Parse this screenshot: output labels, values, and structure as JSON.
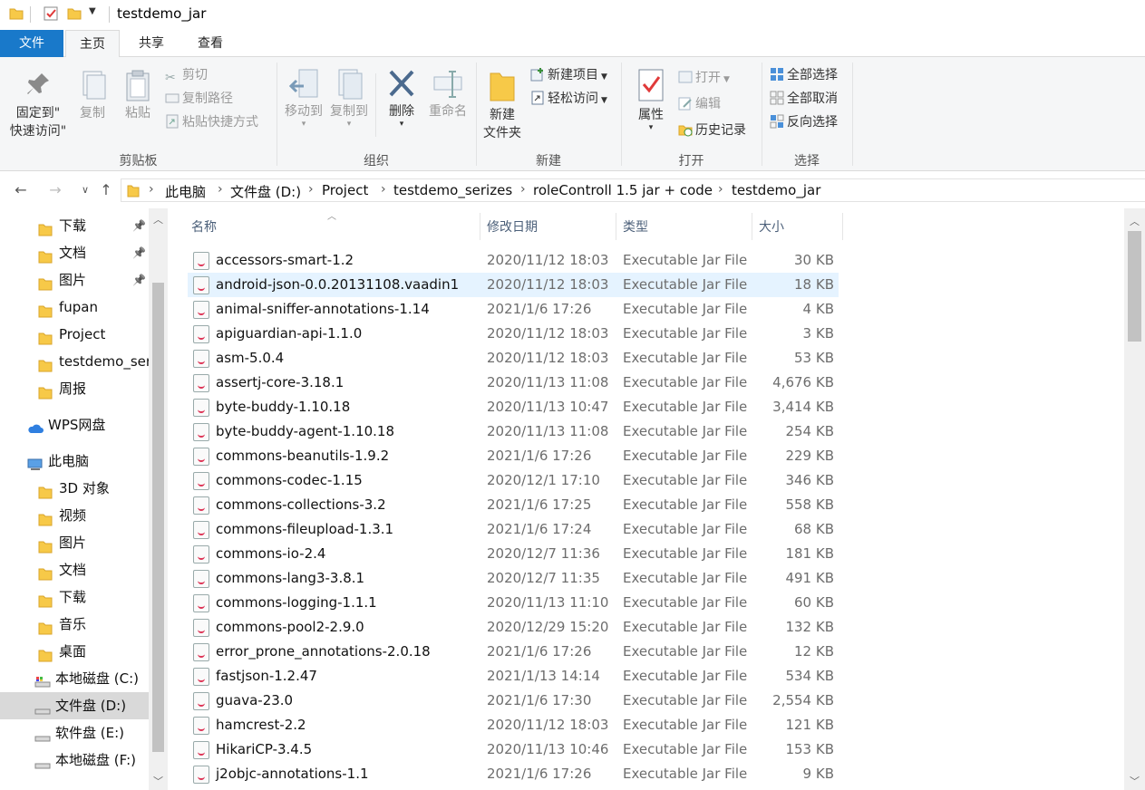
{
  "window": {
    "title": "testdemo_jar"
  },
  "ribbon_tabs": [
    "文件",
    "主页",
    "共享",
    "查看"
  ],
  "ribbon": {
    "clipboard": {
      "pin_label_1": "固定到\"",
      "pin_label_2": "快速访问\"",
      "copy": "复制",
      "paste": "粘贴",
      "cut": "剪切",
      "copy_path": "复制路径",
      "paste_shortcut": "粘贴快捷方式",
      "group": "剪贴板"
    },
    "organize": {
      "move_to": "移动到",
      "copy_to": "复制到",
      "delete": "删除",
      "rename": "重命名",
      "group": "组织"
    },
    "new": {
      "new_folder_1": "新建",
      "new_folder_2": "文件夹",
      "new_item": "新建项目",
      "easy_access": "轻松访问",
      "group": "新建"
    },
    "open": {
      "properties": "属性",
      "open": "打开",
      "edit": "编辑",
      "history": "历史记录",
      "group": "打开"
    },
    "select": {
      "select_all": "全部选择",
      "select_none": "全部取消",
      "invert": "反向选择",
      "group": "选择"
    }
  },
  "breadcrumbs": [
    "此电脑",
    "文件盘 (D:)",
    "Project",
    "testdemo_serizes",
    "roleControll 1.5 jar + code",
    "testdemo_jar"
  ],
  "nav_pane": [
    {
      "label": "下载",
      "pinned": true
    },
    {
      "label": "文档",
      "pinned": true
    },
    {
      "label": "图片",
      "pinned": true
    },
    {
      "label": "fupan",
      "pinned": false
    },
    {
      "label": "Project",
      "pinned": false
    },
    {
      "label": "testdemo_ser",
      "pinned": false
    },
    {
      "label": "周报",
      "pinned": false
    },
    {
      "label": "WPS网盘",
      "pinned": false
    },
    {
      "label": "此电脑",
      "pinned": false
    },
    {
      "label": "3D 对象",
      "pinned": false
    },
    {
      "label": "视频",
      "pinned": false
    },
    {
      "label": "图片",
      "pinned": false
    },
    {
      "label": "文档",
      "pinned": false
    },
    {
      "label": "下载",
      "pinned": false
    },
    {
      "label": "音乐",
      "pinned": false
    },
    {
      "label": "桌面",
      "pinned": false
    },
    {
      "label": "本地磁盘 (C:)",
      "pinned": false
    },
    {
      "label": "文件盘 (D:)",
      "pinned": false,
      "selected": true
    },
    {
      "label": "软件盘 (E:)",
      "pinned": false
    },
    {
      "label": "本地磁盘 (F:)",
      "pinned": false
    }
  ],
  "columns": {
    "name": "名称",
    "date": "修改日期",
    "type": "类型",
    "size": "大小"
  },
  "files": [
    {
      "name": "accessors-smart-1.2",
      "date": "2020/11/12 18:03",
      "type": "Executable Jar File",
      "size": "30 KB"
    },
    {
      "name": "android-json-0.0.20131108.vaadin1",
      "date": "2020/11/12 18:03",
      "type": "Executable Jar File",
      "size": "18 KB",
      "hover": true
    },
    {
      "name": "animal-sniffer-annotations-1.14",
      "date": "2021/1/6 17:26",
      "type": "Executable Jar File",
      "size": "4 KB"
    },
    {
      "name": "apiguardian-api-1.1.0",
      "date": "2020/11/12 18:03",
      "type": "Executable Jar File",
      "size": "3 KB"
    },
    {
      "name": "asm-5.0.4",
      "date": "2020/11/12 18:03",
      "type": "Executable Jar File",
      "size": "53 KB"
    },
    {
      "name": "assertj-core-3.18.1",
      "date": "2020/11/13 11:08",
      "type": "Executable Jar File",
      "size": "4,676 KB"
    },
    {
      "name": "byte-buddy-1.10.18",
      "date": "2020/11/13 10:47",
      "type": "Executable Jar File",
      "size": "3,414 KB"
    },
    {
      "name": "byte-buddy-agent-1.10.18",
      "date": "2020/11/13 11:08",
      "type": "Executable Jar File",
      "size": "254 KB"
    },
    {
      "name": "commons-beanutils-1.9.2",
      "date": "2021/1/6 17:26",
      "type": "Executable Jar File",
      "size": "229 KB"
    },
    {
      "name": "commons-codec-1.15",
      "date": "2020/12/1 17:10",
      "type": "Executable Jar File",
      "size": "346 KB"
    },
    {
      "name": "commons-collections-3.2",
      "date": "2021/1/6 17:25",
      "type": "Executable Jar File",
      "size": "558 KB"
    },
    {
      "name": "commons-fileupload-1.3.1",
      "date": "2021/1/6 17:24",
      "type": "Executable Jar File",
      "size": "68 KB"
    },
    {
      "name": "commons-io-2.4",
      "date": "2020/12/7 11:36",
      "type": "Executable Jar File",
      "size": "181 KB"
    },
    {
      "name": "commons-lang3-3.8.1",
      "date": "2020/12/7 11:35",
      "type": "Executable Jar File",
      "size": "491 KB"
    },
    {
      "name": "commons-logging-1.1.1",
      "date": "2020/11/13 11:10",
      "type": "Executable Jar File",
      "size": "60 KB"
    },
    {
      "name": "commons-pool2-2.9.0",
      "date": "2020/12/29 15:20",
      "type": "Executable Jar File",
      "size": "132 KB"
    },
    {
      "name": "error_prone_annotations-2.0.18",
      "date": "2021/1/6 17:26",
      "type": "Executable Jar File",
      "size": "12 KB"
    },
    {
      "name": "fastjson-1.2.47",
      "date": "2021/1/13 14:14",
      "type": "Executable Jar File",
      "size": "534 KB"
    },
    {
      "name": "guava-23.0",
      "date": "2021/1/6 17:30",
      "type": "Executable Jar File",
      "size": "2,554 KB"
    },
    {
      "name": "hamcrest-2.2",
      "date": "2020/11/12 18:03",
      "type": "Executable Jar File",
      "size": "121 KB"
    },
    {
      "name": "HikariCP-3.4.5",
      "date": "2020/11/13 10:46",
      "type": "Executable Jar File",
      "size": "153 KB"
    },
    {
      "name": "j2objc-annotations-1.1",
      "date": "2021/1/6 17:26",
      "type": "Executable Jar File",
      "size": "9 KB"
    }
  ],
  "colors": {
    "accent": "#1979ca",
    "hover_row": "#e5f3ff",
    "folder": "#f7c948"
  }
}
